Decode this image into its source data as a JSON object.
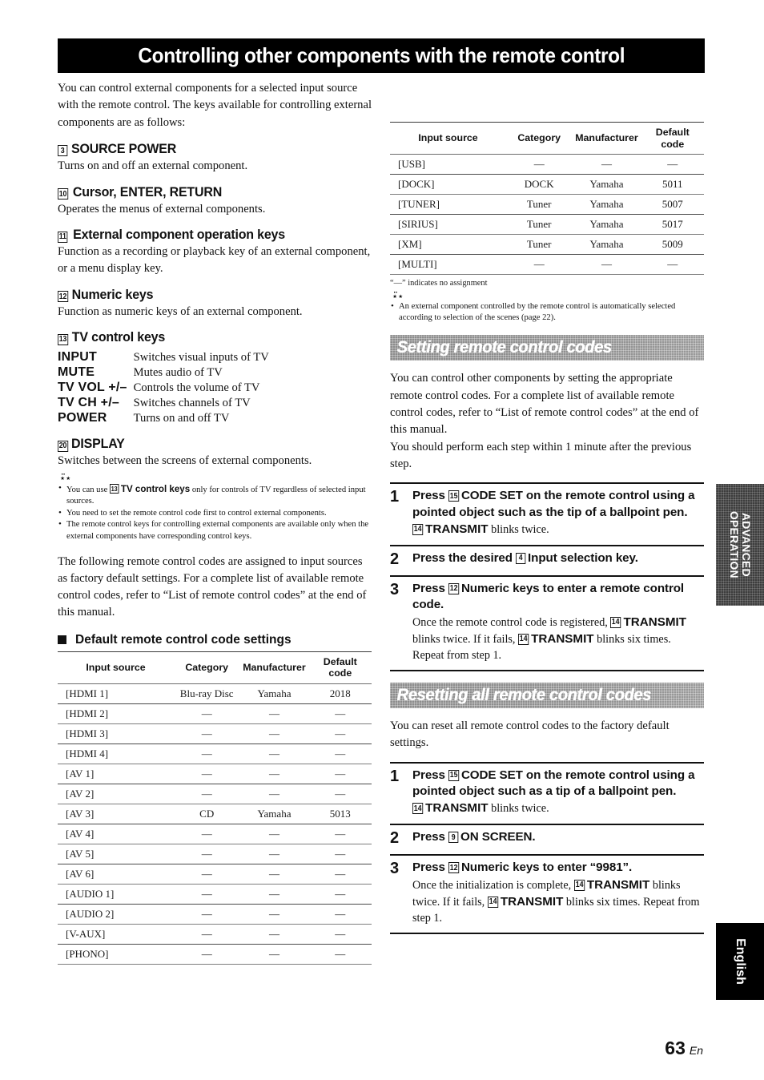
{
  "banner": {
    "title": "Controlling other components with the remote control"
  },
  "intro": "You can control external components for a selected input source with the remote control. The keys available for controlling external components are as follows:",
  "keys": [
    {
      "num": "3",
      "title": "SOURCE POWER",
      "desc": "Turns on and off an external component."
    },
    {
      "num": "10",
      "title": "Cursor, ENTER, RETURN",
      "desc": "Operates the menus of external components."
    },
    {
      "num": "11",
      "title": "External component operation keys",
      "desc": "Function as a recording or playback key of an external component, or a menu display key."
    },
    {
      "num": "12",
      "title": "Numeric keys",
      "desc": "Function as numeric keys of an external component."
    },
    {
      "num": "13",
      "title": "TV control keys",
      "desc": ""
    }
  ],
  "tv_control_keys": [
    {
      "key": "INPUT",
      "desc": "Switches visual inputs of TV"
    },
    {
      "key": "MUTE",
      "desc": "Mutes audio of TV"
    },
    {
      "key": "TV VOL +/–",
      "desc": "Controls the volume of TV"
    },
    {
      "key": "TV CH +/–",
      "desc": "Switches channels of TV"
    },
    {
      "key": "POWER",
      "desc": "Turns on and off TV"
    }
  ],
  "display_key": {
    "num": "20",
    "title": "DISPLAY",
    "desc": "Switches between the screens of external components."
  },
  "tip_icon": "tip-bulb",
  "notes_left": [
    {
      "pre": "You can use ",
      "boxnum": "13",
      "bold": "TV control keys",
      "post": " only for controls of TV regardless of selected input sources."
    },
    {
      "pre": "You need to set the remote control code first to control external components.",
      "boxnum": "",
      "bold": "",
      "post": ""
    },
    {
      "pre": "The remote control keys for controlling external components are available only when the external components have corresponding control keys.",
      "boxnum": "",
      "bold": "",
      "post": ""
    }
  ],
  "body_left": "The following remote control codes are assigned to input sources as factory default settings. For a complete list of available remote control codes, refer to “List of remote control codes” at the end of this manual.",
  "subhead_left": "Default remote control code settings",
  "table": {
    "headers": [
      "Input source",
      "Category",
      "Manufacturer",
      "Default code"
    ],
    "header_default_line1": "Default",
    "header_default_line2": "code",
    "rows_left": [
      [
        "[HDMI 1]",
        "Blu-ray Disc",
        "Yamaha",
        "2018"
      ],
      [
        "[HDMI 2]",
        "—",
        "—",
        "—"
      ],
      [
        "[HDMI 3]",
        "—",
        "—",
        "—"
      ],
      [
        "[HDMI 4]",
        "—",
        "—",
        "—"
      ],
      [
        "[AV 1]",
        "—",
        "—",
        "—"
      ],
      [
        "[AV 2]",
        "—",
        "—",
        "—"
      ],
      [
        "[AV 3]",
        "CD",
        "Yamaha",
        "5013"
      ],
      [
        "[AV 4]",
        "—",
        "—",
        "—"
      ],
      [
        "[AV 5]",
        "—",
        "—",
        "—"
      ],
      [
        "[AV 6]",
        "—",
        "—",
        "—"
      ],
      [
        "[AUDIO 1]",
        "—",
        "—",
        "—"
      ],
      [
        "[AUDIO 2]",
        "—",
        "—",
        "—"
      ],
      [
        "[V-AUX]",
        "—",
        "—",
        "—"
      ],
      [
        "[PHONO]",
        "—",
        "—",
        "—"
      ]
    ],
    "rows_right": [
      [
        "[USB]",
        "—",
        "—",
        "—"
      ],
      [
        "[DOCK]",
        "DOCK",
        "Yamaha",
        "5011"
      ],
      [
        "[TUNER]",
        "Tuner",
        "Yamaha",
        "5007"
      ],
      [
        "[SIRIUS]",
        "Tuner",
        "Yamaha",
        "5017"
      ],
      [
        "[XM]",
        "Tuner",
        "Yamaha",
        "5009"
      ],
      [
        "[MULTI]",
        "—",
        "—",
        "—"
      ]
    ],
    "footnote": "“—” indicates no assignment"
  },
  "note_right": "An external component controlled by the remote control is automatically selected according to selection of the scenes (page 22).",
  "section_setting": {
    "title": "Setting remote control codes",
    "body": "You can control other components by setting the appropriate remote control codes. For a complete list of available remote control codes, refer to “List of remote control codes” at the end of this manual.\nYou should perform each step within 1 minute after the previous step.",
    "body_line1": "You can control other components by setting the appropriate remote control codes. For a complete list of available remote control codes, refer to “List of remote control codes” at the end of this manual.",
    "body_line2": "You should perform each step within 1 minute after the previous step.",
    "steps": [
      {
        "num": "1",
        "title_pre": "Press ",
        "title_boxnum": "15",
        "title_bold": "CODE SET",
        "title_post": " on the remote control using a pointed object such as the tip of a ballpoint pen.",
        "sub_boxnum": "14",
        "sub_bold": "TRANSMIT",
        "sub_post": " blinks twice."
      },
      {
        "num": "2",
        "title_pre": "Press the desired ",
        "title_boxnum": "4",
        "title_bold": "Input selection key",
        "title_post": ".",
        "sub_boxnum": "",
        "sub_bold": "",
        "sub_post": ""
      },
      {
        "num": "3",
        "title_pre": "Press ",
        "title_boxnum": "12",
        "title_bold": "Numeric keys",
        "title_post": " to enter a remote control code.",
        "sub_pre": "Once the remote control code is registered, ",
        "sub_boxnum": "14",
        "sub_bold": "TRANSMIT",
        "sub_mid": " blinks twice. If it fails, ",
        "sub_boxnum2": "14",
        "sub_bold2": "TRANSMIT",
        "sub_post": " blinks six times. Repeat from step 1."
      }
    ]
  },
  "section_reset": {
    "title": "Resetting all remote control codes",
    "body": "You can reset all remote control codes to the factory default settings.",
    "steps": [
      {
        "num": "1",
        "title_pre": "Press ",
        "title_boxnum": "15",
        "title_bold": "CODE SET",
        "title_post": " on the remote control using a pointed object such as a tip of a ballpoint pen.",
        "sub_boxnum": "14",
        "sub_bold": "TRANSMIT",
        "sub_post": " blinks twice."
      },
      {
        "num": "2",
        "title_pre": "Press ",
        "title_boxnum": "9",
        "title_bold": "ON SCREEN",
        "title_post": ".",
        "sub_boxnum": "",
        "sub_bold": "",
        "sub_post": ""
      },
      {
        "num": "3",
        "title_pre": "Press ",
        "title_boxnum": "12",
        "title_bold": "Numeric keys",
        "title_post": " to enter “9981”.",
        "sub_pre": "Once the initialization is complete, ",
        "sub_boxnum": "14",
        "sub_bold": "TRANSMIT",
        "sub_mid": " blinks twice. If it fails, ",
        "sub_boxnum2": "14",
        "sub_bold2": "TRANSMIT",
        "sub_post": " blinks six times. Repeat from step 1."
      }
    ]
  },
  "tabs": {
    "advanced_line1": "ADVANCED",
    "advanced_line2": "OPERATION",
    "english": "English"
  },
  "footer": {
    "page_number": "63",
    "language": "En"
  }
}
